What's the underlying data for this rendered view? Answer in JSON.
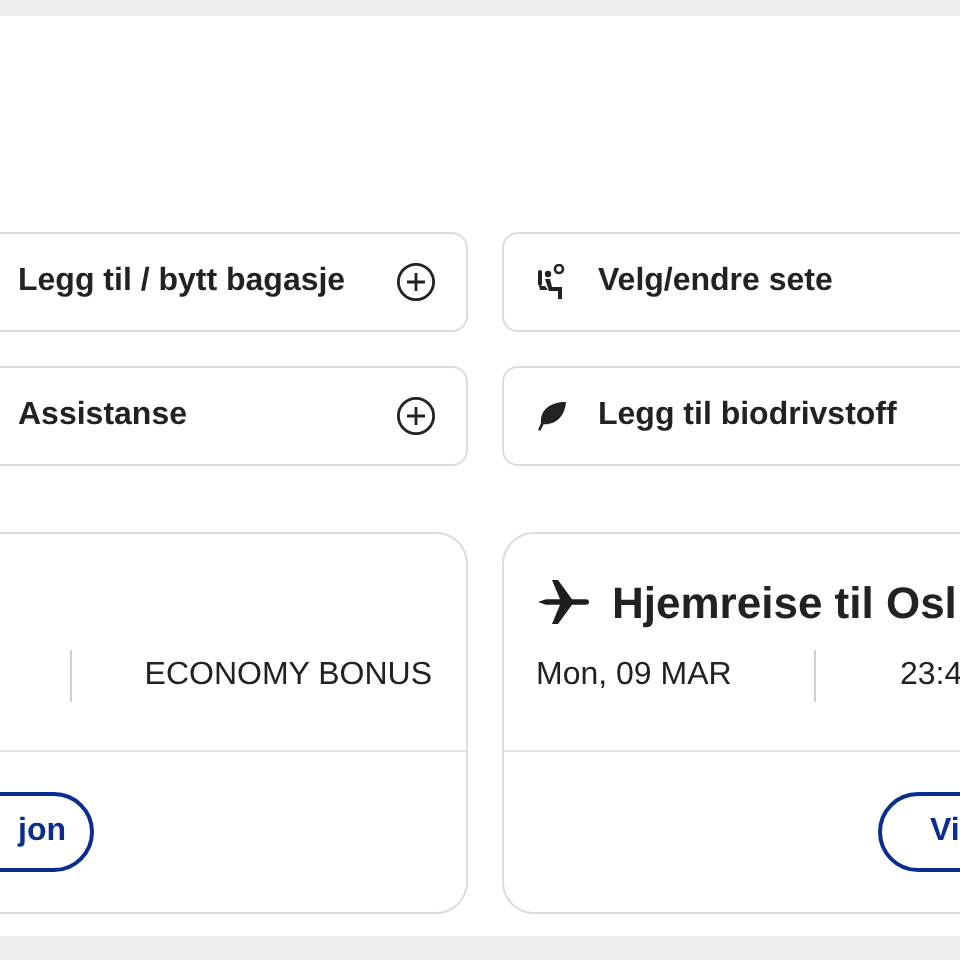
{
  "actions": [
    {
      "label": "Legg til / bytt bagasje",
      "kind": "add"
    },
    {
      "label": "Velg/endre sete",
      "kind": "seat"
    },
    {
      "label": "Assistanse",
      "kind": "add"
    },
    {
      "label": "Legg til biodrivstoff",
      "kind": "leaf"
    }
  ],
  "flights": [
    {
      "fare_class": "ECONOMY BONUS",
      "button": "jon"
    },
    {
      "title": "Hjemreise til Osl",
      "date": "Mon, 09 MAR",
      "time": "23:4",
      "button": "Vi"
    }
  ]
}
